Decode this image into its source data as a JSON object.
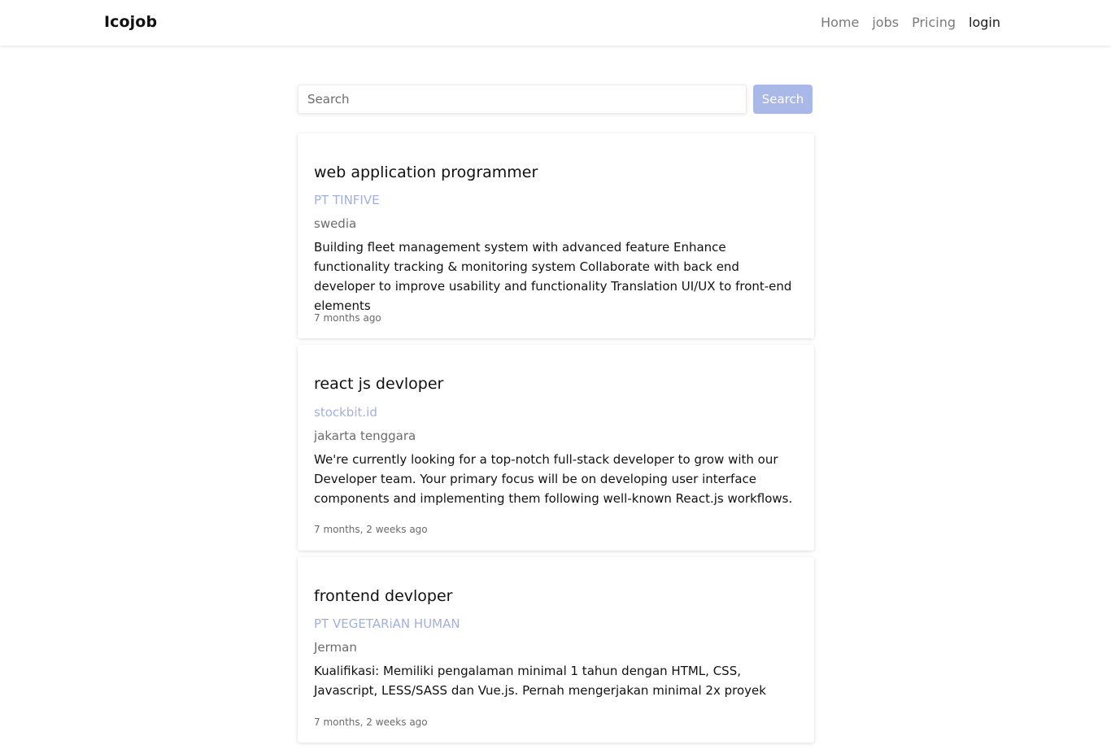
{
  "navbar": {
    "brand": "Icojob",
    "links": [
      {
        "label": "Home"
      },
      {
        "label": "jobs"
      },
      {
        "label": "Pricing"
      },
      {
        "label": "login"
      }
    ]
  },
  "search": {
    "placeholder": "Search",
    "value": "",
    "button_label": "Search"
  },
  "jobs": [
    {
      "title": "web application programmer",
      "company": "PT TINFIVE",
      "location": "swedia",
      "description": "Building fleet management system with advanced feature Enhance functionality tracking & monitoring system Collaborate with back end developer to improve usability and functionality Translation UI/UX to front-end elements",
      "posted": "7 months ago"
    },
    {
      "title": "react js devloper",
      "company": "stockbit.id",
      "location": "jakarta tenggara",
      "description": "We're currently looking for a top-notch full-stack developer to grow with our Developer team. Your primary focus will be on developing user interface components and implementing them following well-known React.js workflows.",
      "posted": "7 months, 2 weeks ago"
    },
    {
      "title": "frontend devloper",
      "company": "PT VEGETARiAN HUMAN",
      "location": "Jerman",
      "description": "Kualifikasi: Memiliki pengalaman minimal 1 tahun dengan HTML, CSS, Javascript, LESS/SASS dan Vue.js. Pernah mengerjakan minimal 2x proyek",
      "posted": "7 months, 2 weeks ago"
    }
  ],
  "colors": {
    "company_link": "#a2b0dc",
    "search_button": "#a9b8e6"
  }
}
